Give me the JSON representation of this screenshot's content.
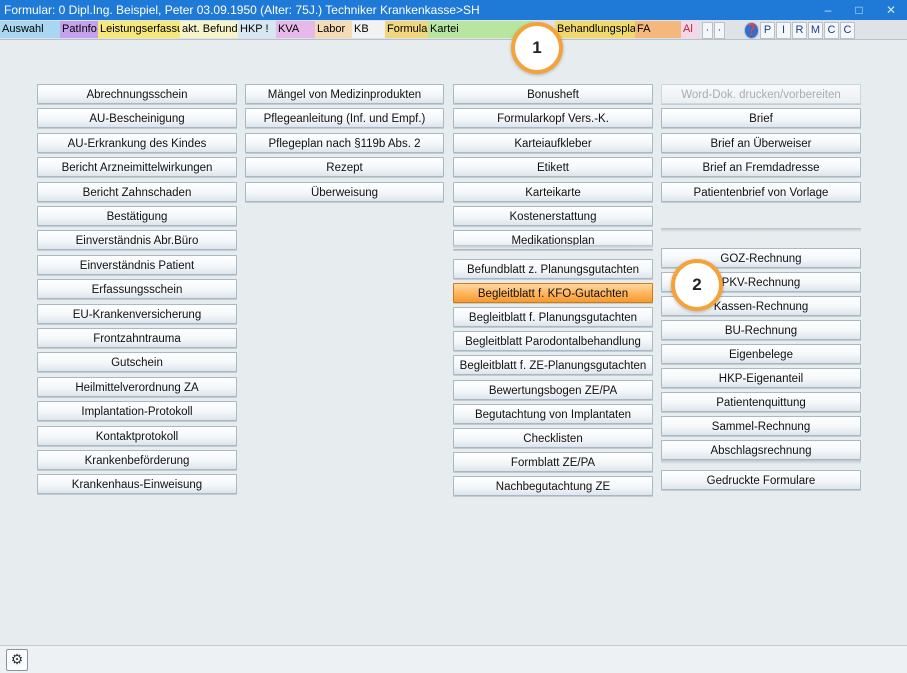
{
  "window": {
    "title": "Formular: 0  Dipl.Ing. Beispiel, Peter  03.09.1950 (Alter: 75J.)  Techniker Krankenkasse>SH",
    "minimize": "–",
    "maximize": "□",
    "close": "✕"
  },
  "tabs": [
    {
      "label": "Auswahl",
      "color": "#a9d6f2"
    },
    {
      "label": "PatInfo",
      "color": "#c4a2ee"
    },
    {
      "label": "Leistungserfassung !",
      "color": "#f6e87a"
    },
    {
      "label": "akt. Befund",
      "color": "#f7f4cc"
    },
    {
      "label": "HKP !",
      "color": "#d7e7f2"
    },
    {
      "label": "KVA",
      "color": "#e6b9ea"
    },
    {
      "label": "Labor",
      "color": "#f3dcb6"
    },
    {
      "label": "KB",
      "color": "#f2f2f2"
    },
    {
      "label": "Formular",
      "color": "#f0d67e"
    },
    {
      "label": "Kartei",
      "color": "#b8e5a0"
    },
    {
      "label": "Behandlungsplanung",
      "color": "#f2d96c"
    },
    {
      "label": "FA",
      "color": "#f4b77c"
    },
    {
      "label": "Al",
      "color": "#f3d8e9",
      "text_color": "#c0203a"
    }
  ],
  "tab_icons": [
    "·",
    "·",
    "❓",
    "P",
    "I",
    "R",
    "M",
    "C",
    "C"
  ],
  "columns": {
    "col1": [
      "Abrechnungsschein",
      "AU-Bescheinigung",
      "AU-Erkrankung des Kindes",
      "Bericht Arzneimittelwirkungen",
      "Bericht Zahnschaden",
      "Bestätigung",
      "Einverständnis Abr.Büro",
      "Einverständnis Patient",
      "Erfassungsschein",
      "EU-Krankenversicherung",
      "Frontzahntrauma",
      "Gutschein",
      "Heilmittelverordnung ZA",
      "Implantation-Protokoll",
      "Kontaktprotokoll",
      "Krankenbeförderung",
      "Krankenhaus-Einweisung"
    ],
    "col2": [
      "Mängel von Medizinprodukten",
      "Pflegeanleitung (Inf. und Empf.)",
      "Pflegeplan nach §119b Abs. 2",
      "Rezept",
      "Überweisung"
    ],
    "col3_top": [
      "Bonusheft",
      "Formularkopf Vers.-K.",
      "Karteiaufkleber",
      "Etikett",
      "Karteikarte",
      "Kostenerstattung",
      "Medikationsplan"
    ],
    "col3_bottom": [
      "Befundblatt z. Planungsgutachten",
      "Begleitblatt f. KFO-Gutachten",
      "Begleitblatt f. Planungsgutachten",
      "Begleitblatt Parodontalbehandlung",
      "Begleitblatt f. ZE-Planungsgutachten",
      "Bewertungsbogen ZE/PA",
      "Begutachtung von Implantaten",
      "Checklisten",
      "Formblatt ZE/PA",
      "Nachbegutachtung ZE"
    ],
    "col4_top": [
      "Word-Dok. drucken/vorbereiten",
      "Brief",
      "Brief an Überweiser",
      "Brief an Fremdadresse",
      "Patientenbrief von Vorlage"
    ],
    "col4_mid": [
      "GOZ-Rechnung",
      "PKV-Rechnung",
      "Kassen-Rechnung",
      "BU-Rechnung",
      "Eigenbelege",
      "HKP-Eigenanteil",
      "Patientenquittung",
      "Sammel-Rechnung",
      "Abschlagsrechnung"
    ],
    "col4_bottom": [
      "Gedruckte Formulare"
    ]
  },
  "highlighted_button": "Begleitblatt f. KFO-Gutachten",
  "disabled_button": "Word-Dok. drucken/vorbereiten",
  "callouts": [
    "1",
    "2"
  ],
  "statusbar": {
    "gear_icon": "⚙"
  },
  "colors": {
    "titlebar": "#1e7ad6",
    "highlight": "#ffb45a",
    "callout_ring": "#f3a33a"
  }
}
